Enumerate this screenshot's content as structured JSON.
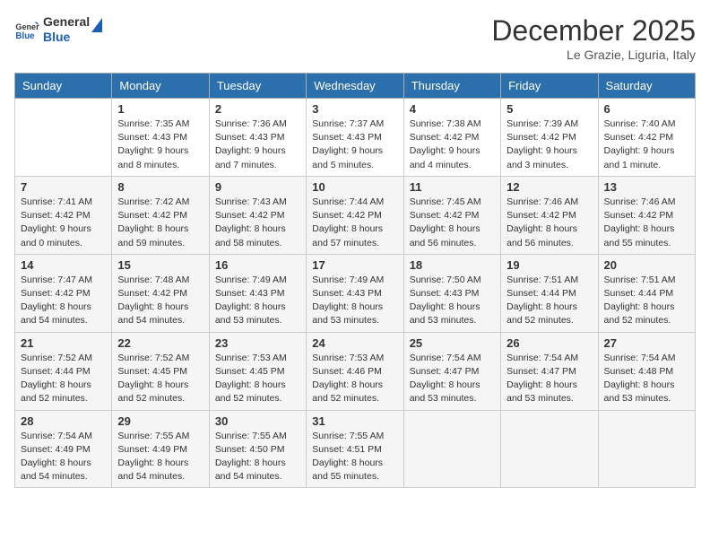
{
  "header": {
    "logo_line1": "General",
    "logo_line2": "Blue",
    "month_title": "December 2025",
    "subtitle": "Le Grazie, Liguria, Italy"
  },
  "days_of_week": [
    "Sunday",
    "Monday",
    "Tuesday",
    "Wednesday",
    "Thursday",
    "Friday",
    "Saturday"
  ],
  "weeks": [
    [
      {
        "day": "",
        "sunrise": "",
        "sunset": "",
        "daylight": ""
      },
      {
        "day": "1",
        "sunrise": "Sunrise: 7:35 AM",
        "sunset": "Sunset: 4:43 PM",
        "daylight": "Daylight: 9 hours and 8 minutes."
      },
      {
        "day": "2",
        "sunrise": "Sunrise: 7:36 AM",
        "sunset": "Sunset: 4:43 PM",
        "daylight": "Daylight: 9 hours and 7 minutes."
      },
      {
        "day": "3",
        "sunrise": "Sunrise: 7:37 AM",
        "sunset": "Sunset: 4:43 PM",
        "daylight": "Daylight: 9 hours and 5 minutes."
      },
      {
        "day": "4",
        "sunrise": "Sunrise: 7:38 AM",
        "sunset": "Sunset: 4:42 PM",
        "daylight": "Daylight: 9 hours and 4 minutes."
      },
      {
        "day": "5",
        "sunrise": "Sunrise: 7:39 AM",
        "sunset": "Sunset: 4:42 PM",
        "daylight": "Daylight: 9 hours and 3 minutes."
      },
      {
        "day": "6",
        "sunrise": "Sunrise: 7:40 AM",
        "sunset": "Sunset: 4:42 PM",
        "daylight": "Daylight: 9 hours and 1 minute."
      }
    ],
    [
      {
        "day": "7",
        "sunrise": "Sunrise: 7:41 AM",
        "sunset": "Sunset: 4:42 PM",
        "daylight": "Daylight: 9 hours and 0 minutes."
      },
      {
        "day": "8",
        "sunrise": "Sunrise: 7:42 AM",
        "sunset": "Sunset: 4:42 PM",
        "daylight": "Daylight: 8 hours and 59 minutes."
      },
      {
        "day": "9",
        "sunrise": "Sunrise: 7:43 AM",
        "sunset": "Sunset: 4:42 PM",
        "daylight": "Daylight: 8 hours and 58 minutes."
      },
      {
        "day": "10",
        "sunrise": "Sunrise: 7:44 AM",
        "sunset": "Sunset: 4:42 PM",
        "daylight": "Daylight: 8 hours and 57 minutes."
      },
      {
        "day": "11",
        "sunrise": "Sunrise: 7:45 AM",
        "sunset": "Sunset: 4:42 PM",
        "daylight": "Daylight: 8 hours and 56 minutes."
      },
      {
        "day": "12",
        "sunrise": "Sunrise: 7:46 AM",
        "sunset": "Sunset: 4:42 PM",
        "daylight": "Daylight: 8 hours and 56 minutes."
      },
      {
        "day": "13",
        "sunrise": "Sunrise: 7:46 AM",
        "sunset": "Sunset: 4:42 PM",
        "daylight": "Daylight: 8 hours and 55 minutes."
      }
    ],
    [
      {
        "day": "14",
        "sunrise": "Sunrise: 7:47 AM",
        "sunset": "Sunset: 4:42 PM",
        "daylight": "Daylight: 8 hours and 54 minutes."
      },
      {
        "day": "15",
        "sunrise": "Sunrise: 7:48 AM",
        "sunset": "Sunset: 4:42 PM",
        "daylight": "Daylight: 8 hours and 54 minutes."
      },
      {
        "day": "16",
        "sunrise": "Sunrise: 7:49 AM",
        "sunset": "Sunset: 4:43 PM",
        "daylight": "Daylight: 8 hours and 53 minutes."
      },
      {
        "day": "17",
        "sunrise": "Sunrise: 7:49 AM",
        "sunset": "Sunset: 4:43 PM",
        "daylight": "Daylight: 8 hours and 53 minutes."
      },
      {
        "day": "18",
        "sunrise": "Sunrise: 7:50 AM",
        "sunset": "Sunset: 4:43 PM",
        "daylight": "Daylight: 8 hours and 53 minutes."
      },
      {
        "day": "19",
        "sunrise": "Sunrise: 7:51 AM",
        "sunset": "Sunset: 4:44 PM",
        "daylight": "Daylight: 8 hours and 52 minutes."
      },
      {
        "day": "20",
        "sunrise": "Sunrise: 7:51 AM",
        "sunset": "Sunset: 4:44 PM",
        "daylight": "Daylight: 8 hours and 52 minutes."
      }
    ],
    [
      {
        "day": "21",
        "sunrise": "Sunrise: 7:52 AM",
        "sunset": "Sunset: 4:44 PM",
        "daylight": "Daylight: 8 hours and 52 minutes."
      },
      {
        "day": "22",
        "sunrise": "Sunrise: 7:52 AM",
        "sunset": "Sunset: 4:45 PM",
        "daylight": "Daylight: 8 hours and 52 minutes."
      },
      {
        "day": "23",
        "sunrise": "Sunrise: 7:53 AM",
        "sunset": "Sunset: 4:45 PM",
        "daylight": "Daylight: 8 hours and 52 minutes."
      },
      {
        "day": "24",
        "sunrise": "Sunrise: 7:53 AM",
        "sunset": "Sunset: 4:46 PM",
        "daylight": "Daylight: 8 hours and 52 minutes."
      },
      {
        "day": "25",
        "sunrise": "Sunrise: 7:54 AM",
        "sunset": "Sunset: 4:47 PM",
        "daylight": "Daylight: 8 hours and 53 minutes."
      },
      {
        "day": "26",
        "sunrise": "Sunrise: 7:54 AM",
        "sunset": "Sunset: 4:47 PM",
        "daylight": "Daylight: 8 hours and 53 minutes."
      },
      {
        "day": "27",
        "sunrise": "Sunrise: 7:54 AM",
        "sunset": "Sunset: 4:48 PM",
        "daylight": "Daylight: 8 hours and 53 minutes."
      }
    ],
    [
      {
        "day": "28",
        "sunrise": "Sunrise: 7:54 AM",
        "sunset": "Sunset: 4:49 PM",
        "daylight": "Daylight: 8 hours and 54 minutes."
      },
      {
        "day": "29",
        "sunrise": "Sunrise: 7:55 AM",
        "sunset": "Sunset: 4:49 PM",
        "daylight": "Daylight: 8 hours and 54 minutes."
      },
      {
        "day": "30",
        "sunrise": "Sunrise: 7:55 AM",
        "sunset": "Sunset: 4:50 PM",
        "daylight": "Daylight: 8 hours and 54 minutes."
      },
      {
        "day": "31",
        "sunrise": "Sunrise: 7:55 AM",
        "sunset": "Sunset: 4:51 PM",
        "daylight": "Daylight: 8 hours and 55 minutes."
      },
      {
        "day": "",
        "sunrise": "",
        "sunset": "",
        "daylight": ""
      },
      {
        "day": "",
        "sunrise": "",
        "sunset": "",
        "daylight": ""
      },
      {
        "day": "",
        "sunrise": "",
        "sunset": "",
        "daylight": ""
      }
    ]
  ]
}
